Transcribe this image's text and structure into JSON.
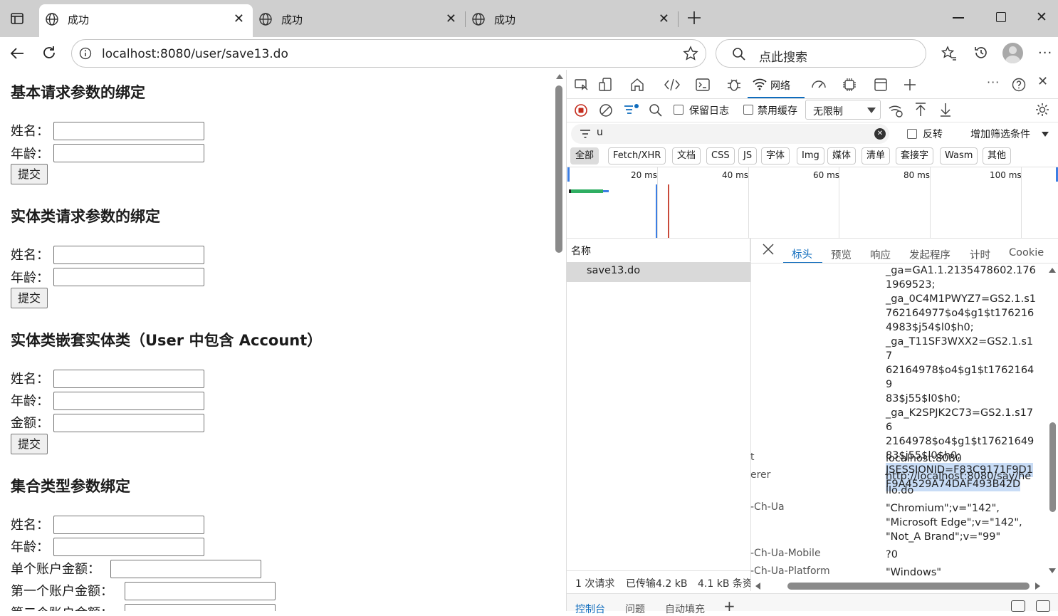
{
  "browser": {
    "tabs": [
      {
        "title": "成功",
        "active": true
      },
      {
        "title": "成功",
        "active": false
      },
      {
        "title": "成功",
        "active": false
      }
    ],
    "address": "localhost:8080/user/save13.do",
    "search_placeholder": "点此搜索"
  },
  "page": {
    "sections": [
      {
        "heading": "基本请求参数的绑定",
        "fields": [
          "姓名：",
          "年龄："
        ],
        "submit": "提交"
      },
      {
        "heading": "实体类请求参数的绑定",
        "fields": [
          "姓名：",
          "年龄："
        ],
        "submit": "提交"
      },
      {
        "heading": "实体类嵌套实体类（User 中包含 Account）",
        "fields": [
          "姓名：",
          "年龄：",
          "金额："
        ],
        "submit": "提交"
      },
      {
        "heading": "集合类型参数绑定",
        "fields": [
          "姓名：",
          "年龄：",
          "单个账户金额：",
          "第一个账户金额：",
          "第二个账户金额："
        ]
      }
    ]
  },
  "devtools": {
    "active_tool": "网络",
    "preserve_log": "保留日志",
    "disable_cache": "禁用缓存",
    "throttle": "无限制",
    "filter_value": "u",
    "invert": "反转",
    "more_filters": "增加筛选条件",
    "type_filters": [
      "全部",
      "Fetch/XHR",
      "文档",
      "CSS",
      "JS",
      "字体",
      "Img",
      "媒体",
      "清单",
      "套接字",
      "Wasm",
      "其他"
    ],
    "timeline_ticks": [
      "20 ms",
      "40 ms",
      "60 ms",
      "80 ms",
      "100 ms"
    ],
    "name_header": "名称",
    "request_name": "save13.do",
    "detail_tabs": [
      "标头",
      "预览",
      "响应",
      "发起程序",
      "计时",
      "Cookie"
    ],
    "cookie_lines": [
      "_ga=GA1.1.2135478602.176",
      "1969523;",
      "_ga_0C4M1PWYZ7=GS2.1.s1",
      "762164977$o4$g1$t176216",
      "4983$j54$l0$h0;",
      "_ga_T11SF3WXX2=GS2.1.s17",
      "62164978$o4$g1$t17621649",
      "83$j55$l0$h0;",
      "_ga_K2SPJK2C73=GS2.1.s176",
      "2164978$o4$g1$t17621649",
      "83$j55$l0$h0;"
    ],
    "session_lines": [
      "JSESSIONID=F83C9171F9D1",
      "F9A4529A74DAF493B42D"
    ],
    "headers": [
      {
        "key": "t",
        "value": [
          "localhost:8080"
        ]
      },
      {
        "key": "erer",
        "value": [
          "http://localhost:8080/say/he",
          "llo.do"
        ]
      },
      {
        "key": "-Ch-Ua",
        "value": [
          "\"Chromium\";v=\"142\",",
          "\"Microsoft Edge\";v=\"142\",",
          "\"Not_A Brand\";v=\"99\""
        ]
      },
      {
        "key": "-Ch-Ua-Mobile",
        "value": [
          "?0"
        ]
      },
      {
        "key": "-Ch-Ua-Platform",
        "value": [
          "\"Windows\""
        ]
      }
    ],
    "status": {
      "requests": "1 次请求",
      "transferred": "已传输4.2 kB",
      "resources": "4.1 kB 条资"
    },
    "drawer_tabs": [
      "控制台",
      "问题",
      "自动填充"
    ]
  }
}
